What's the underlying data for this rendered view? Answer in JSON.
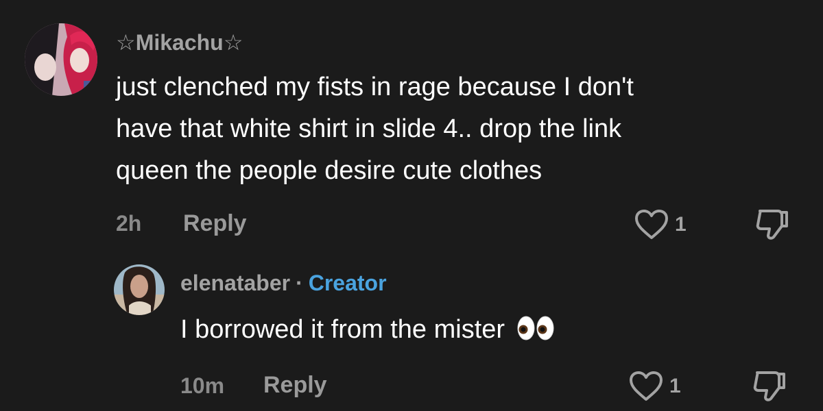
{
  "comments": [
    {
      "username": "☆Mikachu☆",
      "lines": [
        "just clenched my fists in rage because I don't",
        "have that white shirt in slide 4.. drop the link",
        "queen the people desire cute clothes"
      ],
      "time": "2h",
      "reply_label": "Reply",
      "like_count": "1"
    },
    {
      "username": "elenataber",
      "separator": "·",
      "badge": "Creator",
      "text": "I borrowed it from the mister",
      "emoji": "eyes-emoji",
      "time": "10m",
      "reply_label": "Reply",
      "like_count": "1"
    }
  ],
  "colors": {
    "background": "#1b1b1b",
    "username": "#a3a3a3",
    "creator_badge": "#4aa3df",
    "body_text": "#ffffff",
    "meta": "#8a8a8a"
  },
  "icons": {
    "like": "heart-outline-icon",
    "dislike": "thumbs-down-icon"
  }
}
